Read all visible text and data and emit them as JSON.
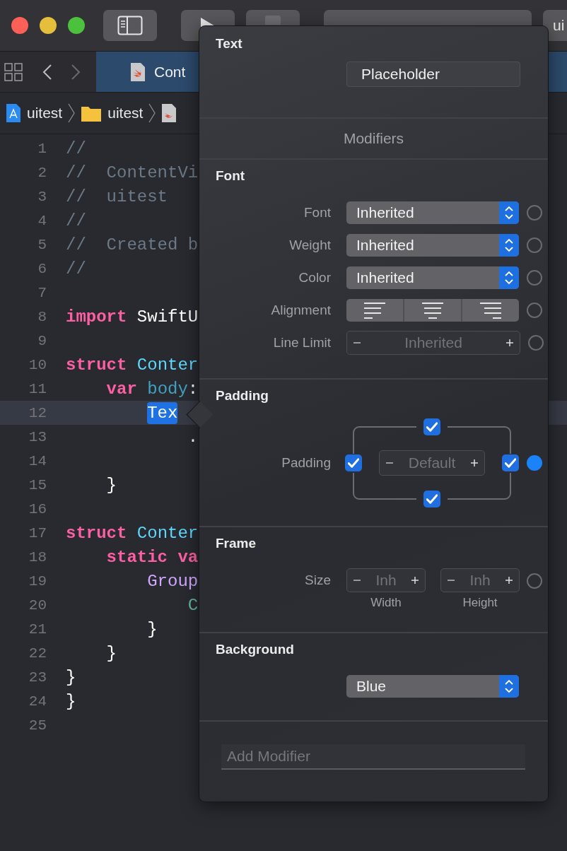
{
  "toolbar": {
    "overflow_button": "ui"
  },
  "tab": {
    "label": "Cont",
    "selected": true
  },
  "breadcrumb": [
    {
      "kind": "project",
      "label": "uitest"
    },
    {
      "kind": "folder",
      "label": "uitest"
    },
    {
      "kind": "file"
    }
  ],
  "editor": {
    "lines": [
      {
        "no": "1",
        "current": false,
        "tokens": [
          {
            "kind": "comment",
            "text": "//"
          }
        ]
      },
      {
        "no": "2",
        "current": false,
        "tokens": [
          {
            "kind": "comment",
            "text": "//  ContentVi"
          }
        ]
      },
      {
        "no": "3",
        "current": false,
        "tokens": [
          {
            "kind": "comment",
            "text": "//  uitest"
          }
        ]
      },
      {
        "no": "4",
        "current": false,
        "tokens": [
          {
            "kind": "comment",
            "text": "//"
          }
        ]
      },
      {
        "no": "5",
        "current": false,
        "tokens": [
          {
            "kind": "comment",
            "text": "//  Created b"
          }
        ]
      },
      {
        "no": "6",
        "current": false,
        "tokens": [
          {
            "kind": "comment",
            "text": "//"
          }
        ]
      },
      {
        "no": "7",
        "current": false
      },
      {
        "no": "8",
        "current": false,
        "tokens": [
          {
            "kind": "keyword",
            "text": "import"
          },
          {
            "kind": "plain",
            "text": " SwiftU"
          }
        ]
      },
      {
        "no": "9",
        "current": false
      },
      {
        "no": "10",
        "current": false,
        "tokens": [
          {
            "kind": "keyword",
            "text": "struct"
          },
          {
            "kind": "type",
            "text": " Conter"
          }
        ]
      },
      {
        "no": "11",
        "current": false,
        "tokens": [
          {
            "kind": "keyword",
            "text": "    var"
          },
          {
            "kind": "property",
            "text": " body"
          },
          {
            "kind": "plain",
            "text": ":"
          }
        ]
      },
      {
        "no": "12",
        "current": true,
        "tokens": [
          {
            "kind": "selected",
            "text": "        Tex"
          }
        ]
      },
      {
        "no": "13",
        "current": false,
        "tokens": [
          {
            "kind": "plain",
            "text": "            ."
          }
        ]
      },
      {
        "no": "14",
        "current": false
      },
      {
        "no": "15",
        "current": false,
        "tokens": [
          {
            "kind": "plain",
            "text": "    }"
          }
        ]
      },
      {
        "no": "16",
        "current": false
      },
      {
        "no": "17",
        "current": false,
        "tokens": [
          {
            "kind": "keyword",
            "text": "struct"
          },
          {
            "kind": "type",
            "text": " Conter"
          }
        ]
      },
      {
        "no": "18",
        "current": false,
        "tokens": [
          {
            "kind": "keyword",
            "text": "    static"
          },
          {
            "kind": "keyword",
            "text": " va"
          }
        ]
      },
      {
        "no": "19",
        "current": false,
        "tokens": [
          {
            "kind": "call",
            "text": "        Group"
          }
        ]
      },
      {
        "no": "20",
        "current": false,
        "tokens": [
          {
            "kind": "member",
            "text": "            C"
          }
        ]
      },
      {
        "no": "21",
        "current": false,
        "tokens": [
          {
            "kind": "plain",
            "text": "        }"
          }
        ]
      },
      {
        "no": "22",
        "current": false,
        "tokens": [
          {
            "kind": "plain",
            "text": "    }"
          }
        ]
      },
      {
        "no": "23",
        "current": false,
        "tokens": [
          {
            "kind": "plain",
            "text": "}"
          }
        ]
      },
      {
        "no": "24",
        "current": false,
        "tokens": [
          {
            "kind": "plain",
            "text": "}"
          }
        ]
      },
      {
        "no": "25",
        "current": false
      }
    ]
  },
  "inspector": {
    "title": "Text",
    "text_value": "Placeholder",
    "modifiers_heading": "Modifiers",
    "sections": [
      {
        "title": "Font",
        "rows": [
          {
            "kind": "popup",
            "label": "Font",
            "value": "Inherited",
            "set": false
          },
          {
            "kind": "popup",
            "label": "Weight",
            "value": "Inherited",
            "set": false
          },
          {
            "kind": "popup",
            "label": "Color",
            "value": "Inherited",
            "set": false
          },
          {
            "kind": "alignment",
            "label": "Alignment",
            "set": false
          },
          {
            "kind": "stepper",
            "label": "Line Limit",
            "value": "Inherited",
            "set": false
          }
        ]
      },
      {
        "title": "Padding",
        "rows": [
          {
            "kind": "padding",
            "label": "Padding",
            "value": "Default",
            "top": true,
            "left": true,
            "right": true,
            "bottom": true,
            "set": true
          }
        ]
      },
      {
        "title": "Frame",
        "rows": [
          {
            "kind": "size",
            "label": "Size",
            "width": {
              "value": "Inh",
              "caption": "Width"
            },
            "height": {
              "value": "Inh",
              "caption": "Height"
            },
            "set": false
          }
        ]
      },
      {
        "title": "Background",
        "rows": [
          {
            "kind": "popup",
            "value": "Blue"
          }
        ]
      }
    ],
    "add_modifier": {
      "placeholder": "Add Modifier"
    }
  }
}
